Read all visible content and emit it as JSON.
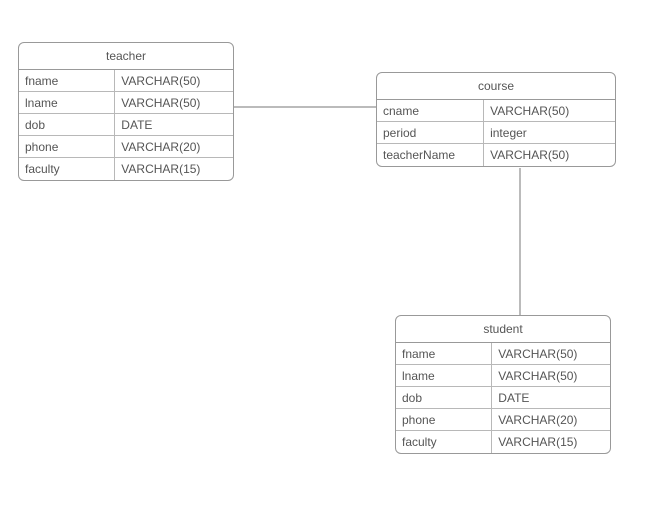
{
  "entities": {
    "teacher": {
      "name": "teacher",
      "columns": [
        {
          "name": "fname",
          "type": "VARCHAR(50)"
        },
        {
          "name": "lname",
          "type": "VARCHAR(50)"
        },
        {
          "name": "dob",
          "type": "DATE"
        },
        {
          "name": "phone",
          "type": "VARCHAR(20)"
        },
        {
          "name": "faculty",
          "type": "VARCHAR(15)"
        }
      ]
    },
    "course": {
      "name": "course",
      "columns": [
        {
          "name": "cname",
          "type": "VARCHAR(50)"
        },
        {
          "name": "period",
          "type": "integer"
        },
        {
          "name": "teacherName",
          "type": "VARCHAR(50)"
        }
      ]
    },
    "student": {
      "name": "student",
      "columns": [
        {
          "name": "fname",
          "type": "VARCHAR(50)"
        },
        {
          "name": "lname",
          "type": "VARCHAR(50)"
        },
        {
          "name": "dob",
          "type": "DATE"
        },
        {
          "name": "phone",
          "type": "VARCHAR(20)"
        },
        {
          "name": "faculty",
          "type": "VARCHAR(15)"
        }
      ]
    }
  },
  "relationships": [
    {
      "from": "teacher",
      "to": "course"
    },
    {
      "from": "course",
      "to": "student"
    }
  ],
  "chart_data": {
    "type": "erd",
    "entities": [
      {
        "name": "teacher",
        "columns": [
          {
            "name": "fname",
            "type": "VARCHAR(50)"
          },
          {
            "name": "lname",
            "type": "VARCHAR(50)"
          },
          {
            "name": "dob",
            "type": "DATE"
          },
          {
            "name": "phone",
            "type": "VARCHAR(20)"
          },
          {
            "name": "faculty",
            "type": "VARCHAR(15)"
          }
        ]
      },
      {
        "name": "course",
        "columns": [
          {
            "name": "cname",
            "type": "VARCHAR(50)"
          },
          {
            "name": "period",
            "type": "integer"
          },
          {
            "name": "teacherName",
            "type": "VARCHAR(50)"
          }
        ]
      },
      {
        "name": "student",
        "columns": [
          {
            "name": "fname",
            "type": "VARCHAR(50)"
          },
          {
            "name": "lname",
            "type": "VARCHAR(50)"
          },
          {
            "name": "dob",
            "type": "DATE"
          },
          {
            "name": "phone",
            "type": "VARCHAR(20)"
          },
          {
            "name": "faculty",
            "type": "VARCHAR(15)"
          }
        ]
      }
    ],
    "relationships": [
      {
        "from": "teacher",
        "to": "course"
      },
      {
        "from": "course",
        "to": "student"
      }
    ]
  }
}
